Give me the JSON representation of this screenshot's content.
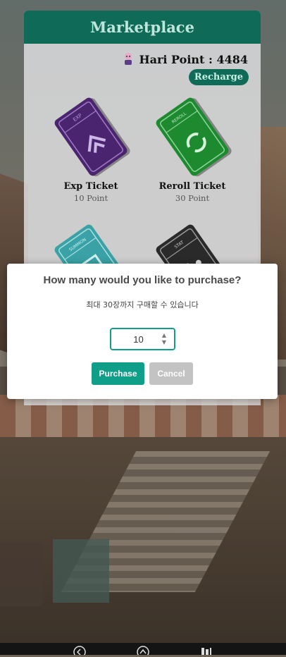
{
  "marketplace": {
    "title": "Marketplace",
    "points_label": "Hari Point : 4484",
    "recharge_label": "Recharge",
    "tickets": [
      {
        "name": "Exp Ticket",
        "price": "10 Point",
        "color": "#4b2470",
        "badge": "EXP",
        "icon": "double-chevron-icon"
      },
      {
        "name": "Reroll Ticket",
        "price": "30 Point",
        "color": "#1d8a2f",
        "badge": "REROLL",
        "icon": "refresh-icon"
      },
      {
        "name": "",
        "price": "",
        "color": "#3aa2a6",
        "badge": "SUMMON",
        "icon": "summon-icon"
      },
      {
        "name": "",
        "price": "",
        "color": "#2a2a2a",
        "badge": "STAT",
        "icon": "stat-icon"
      }
    ]
  },
  "dialog": {
    "title": "How many would you like to purchase?",
    "subtitle": "최대 30장까지 구매할 수 있습니다",
    "quantity": "10",
    "purchase_label": "Purchase",
    "cancel_label": "Cancel"
  },
  "colors": {
    "accent": "#0f6b57",
    "button": "#0f9e88",
    "cancel": "#c3c3c3"
  }
}
